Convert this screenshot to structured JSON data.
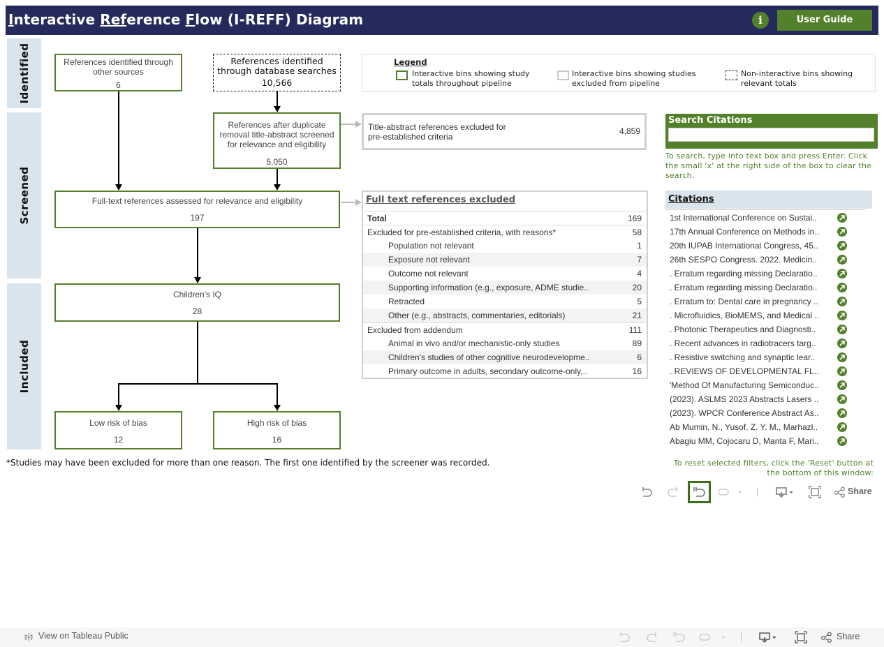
{
  "header": {
    "title_parts": [
      {
        "text": "I",
        "u": true
      },
      {
        "text": "nteractive ",
        "u": false
      },
      {
        "text": "Ref",
        "u": true
      },
      {
        "text": "erence ",
        "u": false
      },
      {
        "text": "F",
        "u": true
      },
      {
        "text": "low (I-REFF) Diagram",
        "u": false
      }
    ],
    "info_icon_glyph": "i",
    "user_guide_label": "User Guide"
  },
  "stages": {
    "identified": "Identified",
    "screened": "Screened",
    "included": "Included"
  },
  "boxes": {
    "other_sources": {
      "label": "References identified through other sources",
      "value": "6"
    },
    "database_searches": {
      "label": "References identified through database searches",
      "value": "10,566"
    },
    "after_duplicates": {
      "label": "References after duplicate removal title-abstract screened for relevance and eligibility",
      "value": "5,050"
    },
    "full_text": {
      "label": "Full-text references assessed for relevance and eligibility",
      "value": "197"
    },
    "childrens_iq": {
      "label": "Children's IQ",
      "value": "28"
    },
    "low_bias": {
      "label": "Low risk of bias",
      "value": "12"
    },
    "high_bias": {
      "label": "High risk of bias",
      "value": "16"
    }
  },
  "legend": {
    "title": "Legend",
    "items": [
      {
        "label": "Interactive bins showing study totals throughout pipeline",
        "swatch": "green-solid"
      },
      {
        "label": "Interactive bins showing studies excluded from pipeline",
        "swatch": "gray-solid"
      },
      {
        "label": "Non-interactive bins showing relevant totals",
        "swatch": "black-dashed"
      }
    ]
  },
  "title_abstract_excluded": {
    "label": "Title-abstract references excluded for pre-established criteria",
    "value": "4,859"
  },
  "full_text_excluded": {
    "title": "Full text references excluded",
    "rows": [
      {
        "label": "Total",
        "value": "169",
        "level": "total"
      },
      {
        "label": "Excluded for pre-established criteria, with reasons*",
        "value": "58",
        "level": "group"
      },
      {
        "label": "Population not relevant",
        "value": "1",
        "level": "sub"
      },
      {
        "label": "Exposure not relevant",
        "value": "7",
        "level": "sub"
      },
      {
        "label": "Outcome not relevant",
        "value": "4",
        "level": "sub"
      },
      {
        "label": "Supporting information (e.g., exposure, ADME studie..",
        "value": "20",
        "level": "sub"
      },
      {
        "label": "Retracted",
        "value": "5",
        "level": "sub"
      },
      {
        "label": "Other (e.g., abstracts, commentaries, editorials)",
        "value": "21",
        "level": "sub"
      },
      {
        "label": "Excluded from addendum",
        "value": "111",
        "level": "group"
      },
      {
        "label": "Animal in vivo and/or mechanistic-only studies",
        "value": "89",
        "level": "sub"
      },
      {
        "label": "Children's studies of other cognitive neurodevelopme..",
        "value": "6",
        "level": "sub"
      },
      {
        "label": "Primary outcome in adults, secondary outcome-only,..",
        "value": "16",
        "level": "sub"
      }
    ]
  },
  "search": {
    "title": "Search Citations",
    "value": "",
    "help": "To search, type into text box and press Enter. Click the small 'x' at the right side of the box to clear the search."
  },
  "citations": {
    "header": "Citations",
    "items": [
      "1st International Conference on Sustai..",
      "17th Annual Conference on Methods in..",
      "20th IUPAB International Congress, 45..",
      "26th SESPO Congress. 2022. Medicin..",
      ". Erratum regarding missing Declaratio..",
      ". Erratum regarding missing Declaratio..",
      ". Erratum to: Dental care in pregnancy ..",
      ". Microfluidics, BioMEMS, and Medical ..",
      ". Photonic Therapeutics and Diagnosti..",
      ". Recent advances in radiotracers targ..",
      ". Resistive switching and synaptic lear..",
      ". REVIEWS OF DEVELOPMENTAL FL..",
      "'Method Of Manufacturing Semiconduc..",
      "(2023). ASLMS 2023 Abstracts Lasers ..",
      "(2023). WPCR Conference Abstract As..",
      "Ab Mumin, N., Yusof, Z. Y. M., Marhazl..",
      "Abagiu MM, Cojocaru D, Manta F, Mari.."
    ],
    "link_icon": "arrow-up-right-circle-icon"
  },
  "footnote": "*Studies may have been excluded for more than one reason. The first one identified by the screener was recorded.",
  "reset_help": "To reset selected filters, click the 'Reset' button at the bottom of this window:",
  "toolbar": {
    "share_label": "Share"
  },
  "bottom_bar": {
    "tableau_link": "View on Tableau Public",
    "share_label": "Share"
  },
  "colors": {
    "header_bg": "#252a5c",
    "accent_green": "#53802a",
    "stage_bg": "#d9e4ec"
  }
}
